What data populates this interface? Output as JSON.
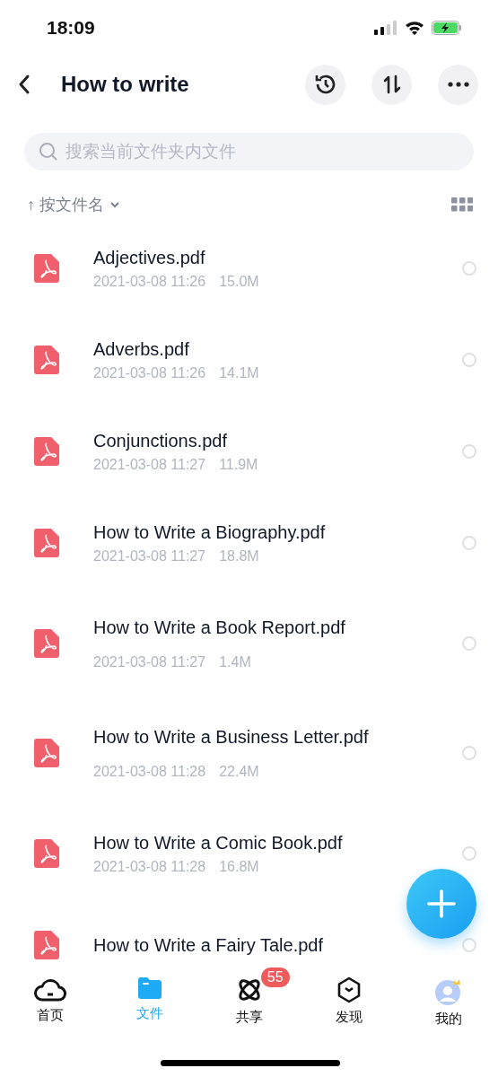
{
  "status_bar": {
    "time": "18:09"
  },
  "header": {
    "title": "How to write"
  },
  "search": {
    "placeholder": "搜索当前文件夹内文件"
  },
  "sort": {
    "arrow": "↑",
    "label": "按文件名"
  },
  "files": [
    {
      "name": "Adjectives.pdf",
      "date": "2021-03-08 11:26",
      "size": "15.0M",
      "selected": false
    },
    {
      "name": "Adverbs.pdf",
      "date": "2021-03-08 11:26",
      "size": "14.1M",
      "selected": false
    },
    {
      "name": "Conjunctions.pdf",
      "date": "2021-03-08 11:27",
      "size": "11.9M",
      "selected": false
    },
    {
      "name": "How to Write a Biography.pdf",
      "date": "2021-03-08 11:27",
      "size": "18.8M",
      "selected": false
    },
    {
      "name": "How to Write a Book Report.pdf",
      "date": "2021-03-08 11:27",
      "size": "1.4M",
      "selected": false
    },
    {
      "name": "How to Write a Business Letter.pdf",
      "date": "2021-03-08 11:28",
      "size": "22.4M",
      "selected": false
    },
    {
      "name": "How to Write a Comic Book.pdf",
      "date": "2021-03-08 11:28",
      "size": "16.8M",
      "selected": false
    },
    {
      "name": "How to Write a Fairy Tale.pdf",
      "selected": false
    }
  ],
  "tabs": [
    {
      "kind": "home",
      "label": "首页",
      "selected": false
    },
    {
      "kind": "files",
      "label": "文件",
      "selected": true
    },
    {
      "kind": "share",
      "label": "共享",
      "selected": false,
      "badge": "55"
    },
    {
      "kind": "discover",
      "label": "发现",
      "selected": false
    },
    {
      "kind": "me",
      "label": "我的",
      "selected": false
    }
  ]
}
